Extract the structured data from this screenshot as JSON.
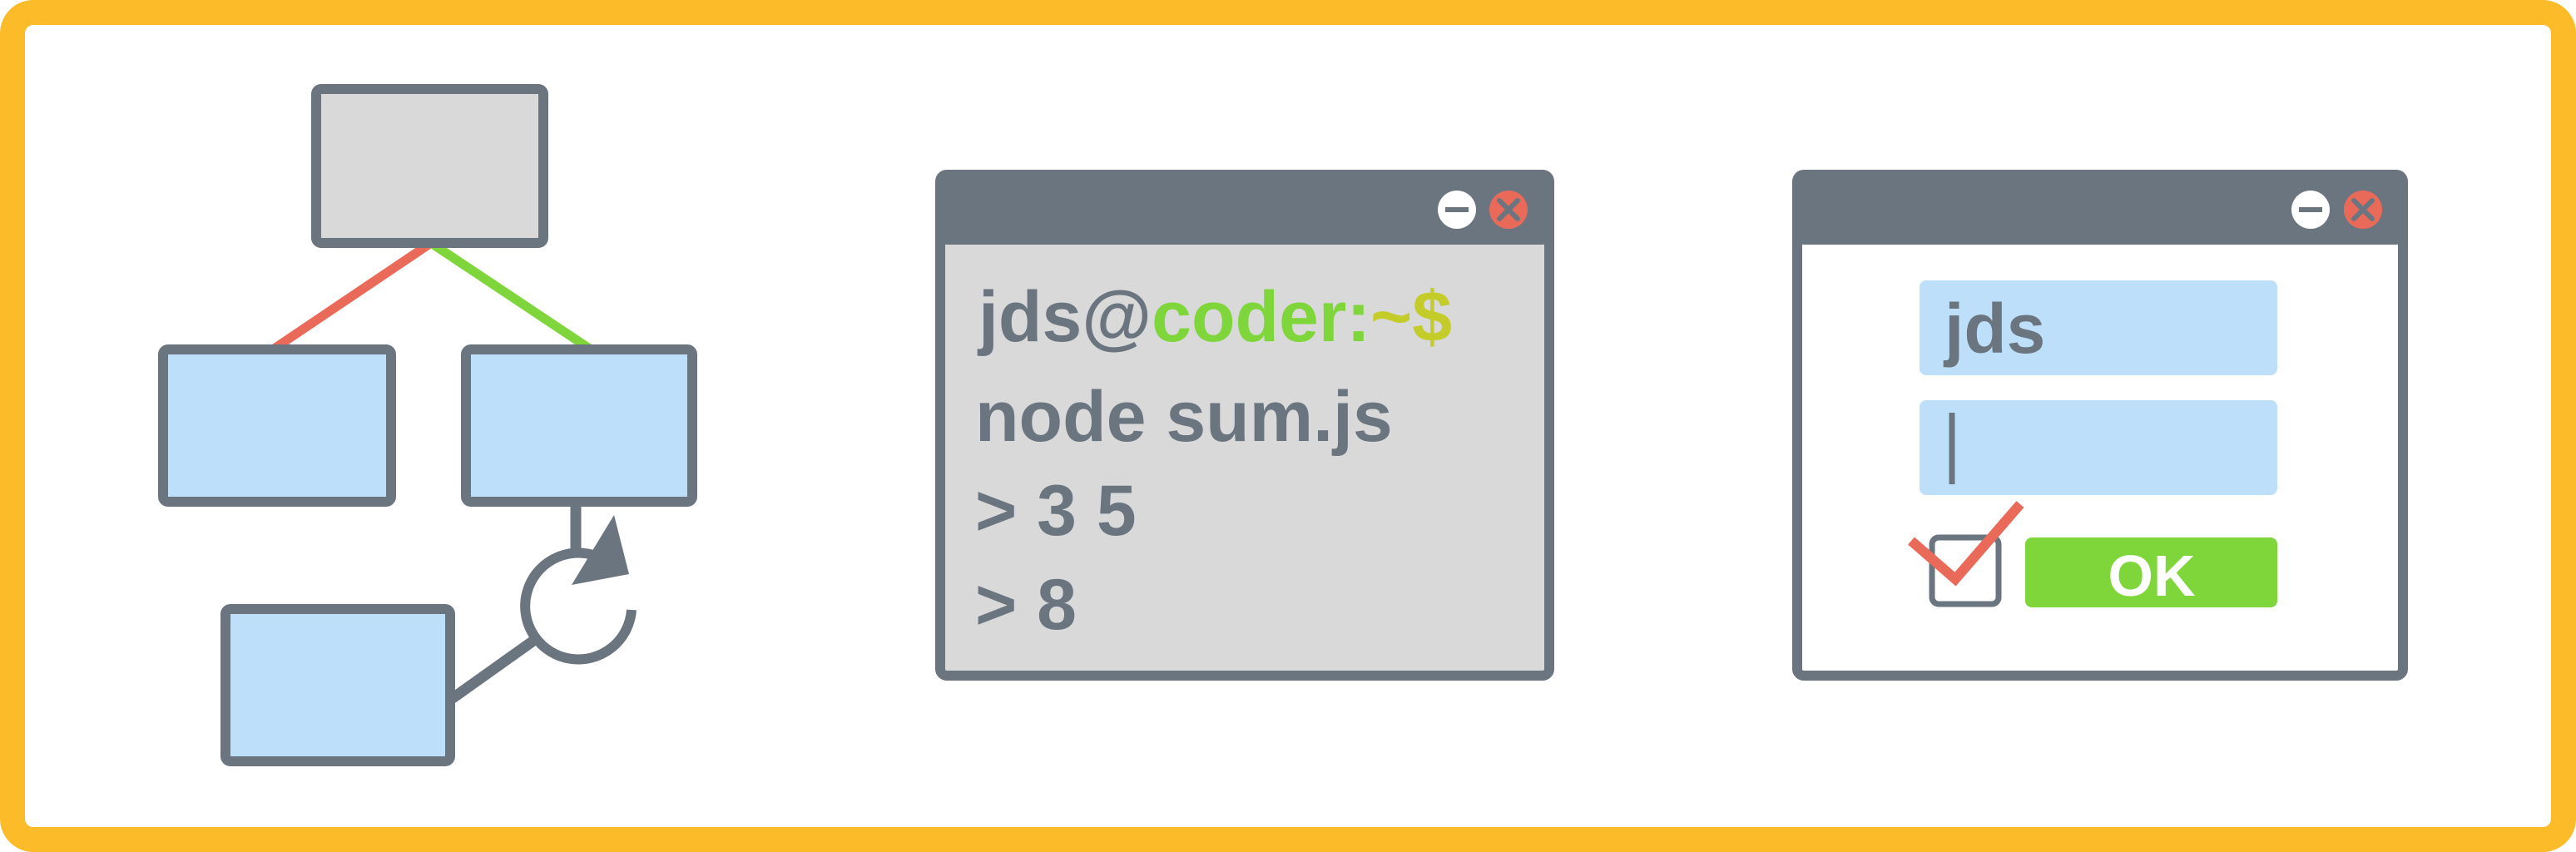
{
  "colors": {
    "frame": "#FCBC2A",
    "outline": "#6B7580",
    "node_gray": "#D9D9D9",
    "node_blue": "#BEDFFA",
    "edge_red": "#EA6A5A",
    "edge_green": "#7FD63A",
    "terminal_bg": "#D9D9D9",
    "titlebar": "#6B7580",
    "minimize_button": "#FFFFFF",
    "close_button": "#EA6A5A",
    "prompt_host": "#7FD63A",
    "prompt_dollar": "#C4CC2A",
    "ok_button": "#7FD63A",
    "input_bg": "#BEDFFA",
    "check_mark": "#EA6A5A"
  },
  "terminal": {
    "prompt_user": "jds@",
    "prompt_host": "coder:",
    "prompt_dir": "~$",
    "line_command": "node sum.js",
    "line_input": "> 3 5",
    "line_output": "> 8"
  },
  "form": {
    "username_value": "jds",
    "password_value": "",
    "remember_checked": true,
    "ok_label": "OK"
  },
  "icons": {
    "minimize": "minus-icon",
    "close": "x-icon",
    "loop": "circular-arrow-icon",
    "check": "check-icon"
  }
}
